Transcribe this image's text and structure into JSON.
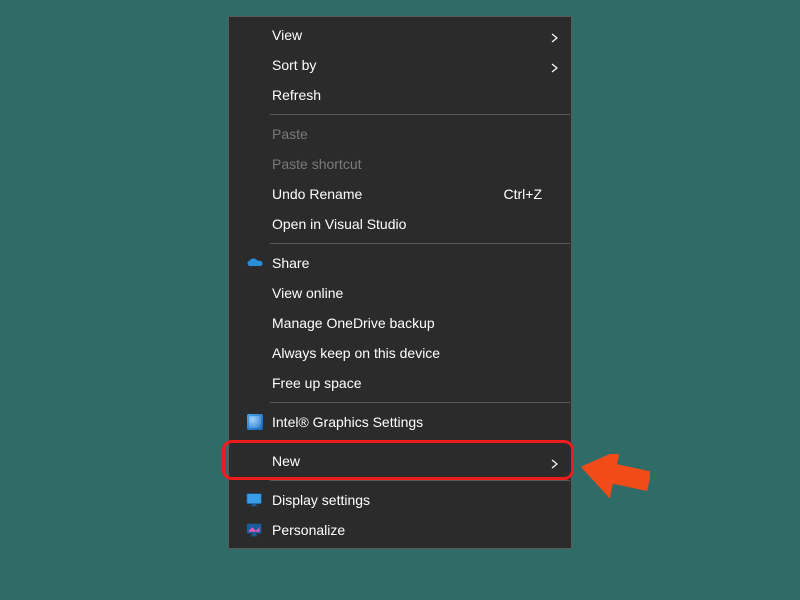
{
  "menu": {
    "items": [
      {
        "label": "View",
        "hasSubmenu": true
      },
      {
        "label": "Sort by",
        "hasSubmenu": true
      },
      {
        "label": "Refresh"
      },
      {
        "label": "Paste",
        "disabled": true
      },
      {
        "label": "Paste shortcut",
        "disabled": true
      },
      {
        "label": "Undo Rename",
        "shortcut": "Ctrl+Z"
      },
      {
        "label": "Open in Visual Studio"
      },
      {
        "label": "Share"
      },
      {
        "label": "View online"
      },
      {
        "label": "Manage OneDrive backup"
      },
      {
        "label": "Always keep on this device"
      },
      {
        "label": "Free up space"
      },
      {
        "label": "Intel® Graphics Settings"
      },
      {
        "label": "New",
        "hasSubmenu": true
      },
      {
        "label": "Display settings"
      },
      {
        "label": "Personalize"
      }
    ]
  }
}
